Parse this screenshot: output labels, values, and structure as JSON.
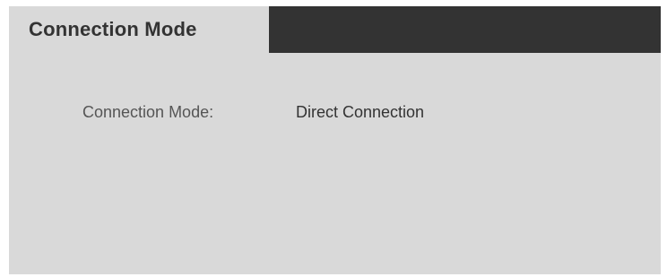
{
  "panel": {
    "tab_title": "Connection Mode",
    "fields": [
      {
        "label": "Connection Mode:",
        "value": "Direct Connection"
      }
    ]
  },
  "colors": {
    "header_bar": "#333333",
    "panel_background": "#d9d9d9",
    "label_text": "#555555",
    "value_text": "#333333"
  }
}
